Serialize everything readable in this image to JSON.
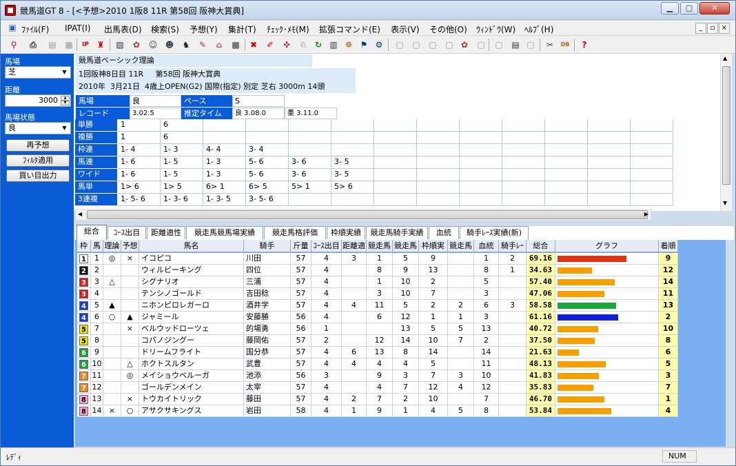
{
  "window": {
    "title": "競馬道GT 8  - [<予想>2010 1阪8 11R 第58回 阪神大賞典]"
  },
  "menu": [
    "ﾌｧｲﾙ(F)",
    "IPAT(I)",
    "出馬表(D)",
    "検索(S)",
    "予想(Y)",
    "集計(T)",
    "ﾁｪｯｸ･ﾒﾓ(M)",
    "拡張コマンド(E)",
    "表示(V)",
    "その他(O)",
    "ｳｨﾝﾄﾞｳ(W)",
    "ﾍﾙﾌﾟ(H)"
  ],
  "sidebar": {
    "track_label": "馬場",
    "track_value": "芝",
    "distance_label": "距離",
    "distance_value": "3000",
    "condition_label": "馬場状態",
    "condition_value": "良",
    "buttons": [
      "再予想",
      "ﾌｨﾙﾀ適用",
      "買い目出力"
    ]
  },
  "race": {
    "theory": "競馬道ベーシック理論",
    "line1": "1回阪神8日目 11R     第58回 阪神大賞典",
    "line2": "2010年  3月21日  4歳上OPEN(G2) 国際(指定) 別定 芝右 3000m 14頭",
    "baba_label": "馬場",
    "baba_value": "良",
    "pace_label": "ペース",
    "pace_value": "S",
    "record_label": "レコード",
    "record_value": "3.02.5",
    "est_label": "推定タイム",
    "est_good": "良 3.08.0",
    "est_heavy": "重 3.11.0"
  },
  "payouts": [
    {
      "label": "単勝",
      "vals": [
        "1",
        "6"
      ]
    },
    {
      "label": "複勝",
      "vals": [
        "1",
        "6"
      ]
    },
    {
      "label": "枠連",
      "vals": [
        "1- 4",
        "1- 3",
        "4- 4",
        "3- 4"
      ]
    },
    {
      "label": "馬連",
      "vals": [
        "1- 6",
        "1- 5",
        "1- 3",
        "5- 6",
        "3- 6",
        "3- 5"
      ]
    },
    {
      "label": "ワイド",
      "vals": [
        "1- 6",
        "1- 5",
        "1- 3",
        "5- 6",
        "3- 6",
        "3- 5"
      ]
    },
    {
      "label": "馬単",
      "vals": [
        "1> 6",
        "1> 5",
        "6> 1",
        "6> 5",
        "5> 1",
        "5> 6"
      ]
    },
    {
      "label": "3連複",
      "vals": [
        "1- 5- 6",
        "1- 3- 6",
        "1- 3- 5",
        "3- 5- 6"
      ]
    }
  ],
  "tabs": [
    "総合",
    "ｺｰｽ出目",
    "距離適性",
    "競走馬競馬場実績",
    "競走馬格評価",
    "枠順実績",
    "競走馬騎手実績",
    "血統",
    "騎手ﾚｰｽ実績(新)"
  ],
  "columns": [
    "枠",
    "馬",
    "理論",
    "予想",
    "馬名",
    "騎手",
    "斤量",
    "ｺｰｽ出目",
    "距離適",
    "競走馬",
    "競走馬",
    "枠順実",
    "競走馬",
    "血統",
    "騎手ﾚｰ",
    "総合",
    "グラフ",
    "着順"
  ],
  "colors": {
    "waku": [
      "#ffffff",
      "#111111",
      "#e01818",
      "#1a3ad8",
      "#f5e300",
      "#1aa238",
      "#f08c1e",
      "#ff9fd0"
    ],
    "bar_default": "#f5a000",
    "bar_red": "#e83010",
    "bar_green": "#18a838",
    "bar_blue": "#1020d8"
  },
  "rows": [
    {
      "waku": 1,
      "num": "1",
      "theory": "◎",
      "pred": "×",
      "name": "イコピコ",
      "jockey": "川田",
      "kin": "57",
      "c1": "4",
      "c2": "3",
      "c3": "1",
      "c4": "5",
      "c5": "9",
      "c6": "",
      "c7": "1",
      "c8": "2",
      "score": "69.16",
      "rank": "9",
      "bar": "red",
      "sv": 69.16
    },
    {
      "waku": 2,
      "num": "2",
      "theory": "",
      "pred": "",
      "name": "ウィルビーキング",
      "jockey": "四位",
      "kin": "57",
      "c1": "4",
      "c2": "",
      "c3": "8",
      "c4": "9",
      "c5": "13",
      "c6": "",
      "c7": "8",
      "c8": "1",
      "score": "34.63",
      "rank": "12",
      "bar": "default",
      "sv": 34.63
    },
    {
      "waku": 3,
      "num": "3",
      "theory": "△",
      "pred": "",
      "name": "シグナリオ",
      "jockey": "三浦",
      "kin": "57",
      "c1": "4",
      "c2": "",
      "c3": "1",
      "c4": "10",
      "c5": "2",
      "c6": "",
      "c7": "5",
      "c8": "",
      "score": "57.40",
      "rank": "14",
      "bar": "default",
      "sv": 57.4
    },
    {
      "waku": 3,
      "num": "4",
      "theory": "",
      "pred": "",
      "name": "テンシノゴールド",
      "jockey": "吉田稔",
      "kin": "57",
      "c1": "4",
      "c2": "",
      "c3": "3",
      "c4": "10",
      "c5": "7",
      "c6": "",
      "c7": "3",
      "c8": "",
      "score": "47.06",
      "rank": "11",
      "bar": "default",
      "sv": 47.06
    },
    {
      "waku": 4,
      "num": "5",
      "theory": "▲",
      "pred": "",
      "name": "ニホンピロレガーロ",
      "jockey": "酒井学",
      "kin": "57",
      "c1": "4",
      "c2": "4",
      "c3": "11",
      "c4": "5",
      "c5": "2",
      "c6": "2",
      "c7": "6",
      "c8": "3",
      "score": "58.58",
      "rank": "13",
      "bar": "green",
      "sv": 58.58
    },
    {
      "waku": 4,
      "num": "6",
      "theory": "○",
      "pred": "▲",
      "name": "ジャミール",
      "jockey": "安藤勝",
      "kin": "56",
      "c1": "4",
      "c2": "",
      "c3": "6",
      "c4": "12",
      "c5": "1",
      "c6": "1",
      "c7": "3",
      "c8": "",
      "score": "61.16",
      "rank": "2",
      "bar": "blue",
      "sv": 61.16
    },
    {
      "waku": 5,
      "num": "7",
      "theory": "",
      "pred": "×",
      "name": "ベルウッドローツェ",
      "jockey": "的場勇",
      "kin": "56",
      "c1": "1",
      "c2": "",
      "c3": "",
      "c4": "13",
      "c5": "5",
      "c6": "5",
      "c7": "13",
      "c8": "",
      "score": "40.72",
      "rank": "10",
      "bar": "default",
      "sv": 40.72
    },
    {
      "waku": 5,
      "num": "8",
      "theory": "",
      "pred": "",
      "name": "コパノジングー",
      "jockey": "藤岡佑",
      "kin": "57",
      "c1": "2",
      "c2": "",
      "c3": "12",
      "c4": "14",
      "c5": "10",
      "c6": "7",
      "c7": "2",
      "c8": "",
      "score": "37.50",
      "rank": "8",
      "bar": "default",
      "sv": 37.5
    },
    {
      "waku": 6,
      "num": "9",
      "theory": "",
      "pred": "",
      "name": "ドリームフライト",
      "jockey": "国分恭",
      "kin": "57",
      "c1": "4",
      "c2": "6",
      "c3": "13",
      "c4": "8",
      "c5": "14",
      "c6": "",
      "c7": "14",
      "c8": "",
      "score": "21.63",
      "rank": "6",
      "bar": "default",
      "sv": 21.63
    },
    {
      "waku": 6,
      "num": "10",
      "theory": "",
      "pred": "△",
      "name": "ホクトスルタン",
      "jockey": "武豊",
      "kin": "57",
      "c1": "4",
      "c2": "4",
      "c3": "4",
      "c4": "4",
      "c5": "5",
      "c6": "",
      "c7": "11",
      "c8": "",
      "score": "48.13",
      "rank": "5",
      "bar": "default",
      "sv": 48.13
    },
    {
      "waku": 7,
      "num": "11",
      "theory": "",
      "pred": "◎",
      "name": "メイショウベルーガ",
      "jockey": "池添",
      "kin": "56",
      "c1": "3",
      "c2": "",
      "c3": "9",
      "c4": "3",
      "c5": "7",
      "c6": "3",
      "c7": "10",
      "c8": "",
      "score": "41.83",
      "rank": "3",
      "bar": "default",
      "sv": 41.83
    },
    {
      "waku": 7,
      "num": "12",
      "theory": "",
      "pred": "",
      "name": "ゴールデンメイン",
      "jockey": "太宰",
      "kin": "57",
      "c1": "4",
      "c2": "",
      "c3": "4",
      "c4": "7",
      "c5": "12",
      "c6": "4",
      "c7": "12",
      "c8": "",
      "score": "35.83",
      "rank": "7",
      "bar": "default",
      "sv": 35.83
    },
    {
      "waku": 8,
      "num": "13",
      "theory": "",
      "pred": "×",
      "name": "トウカイトリック",
      "jockey": "藤田",
      "kin": "57",
      "c1": "4",
      "c2": "2",
      "c3": "7",
      "c4": "2",
      "c5": "10",
      "c6": "",
      "c7": "7",
      "c8": "",
      "score": "46.70",
      "rank": "1",
      "bar": "default",
      "sv": 46.7
    },
    {
      "waku": 8,
      "num": "14",
      "theory": "×",
      "pred": "○",
      "name": "アサクサキングス",
      "jockey": "岩田",
      "kin": "58",
      "c1": "4",
      "c2": "1",
      "c3": "9",
      "c4": "1",
      "c5": "4",
      "c6": "5",
      "c7": "8",
      "c8": "",
      "score": "53.84",
      "rank": "4",
      "bar": "default",
      "sv": 53.84
    }
  ],
  "status": {
    "left": "ﾚﾃﾞｨ",
    "right": "NUM"
  }
}
